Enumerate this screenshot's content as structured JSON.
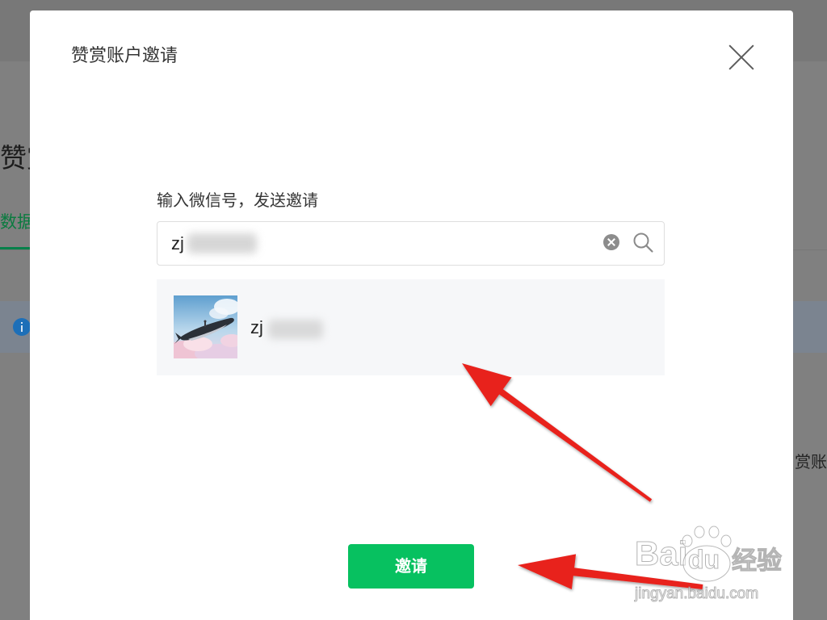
{
  "background_page": {
    "title_fragment": "赞赏",
    "tab_fragment": "数据",
    "side_text_fragment": "赏账",
    "info_icon": "info-icon"
  },
  "dialog": {
    "title": "赞赏账户邀请",
    "close_icon": "close-icon",
    "prompt": "输入微信号，发送邀请",
    "search": {
      "value": "zj",
      "clear_icon": "clear-circle-icon",
      "search_icon": "search-icon"
    },
    "results": [
      {
        "name": "zj",
        "avatar": "whale-in-sky-avatar"
      }
    ],
    "invite_button": "邀请"
  },
  "watermark": {
    "brand_left": "Bai",
    "brand_right": "du",
    "brand_cn": "经验",
    "url": "jingyan.baidu.com",
    "logo_icon": "paw-icon"
  },
  "colors": {
    "accent": "#07c160",
    "annotation_arrow": "#e8211d",
    "info_icon": "#1d6fb8",
    "overlay": "#808080"
  }
}
